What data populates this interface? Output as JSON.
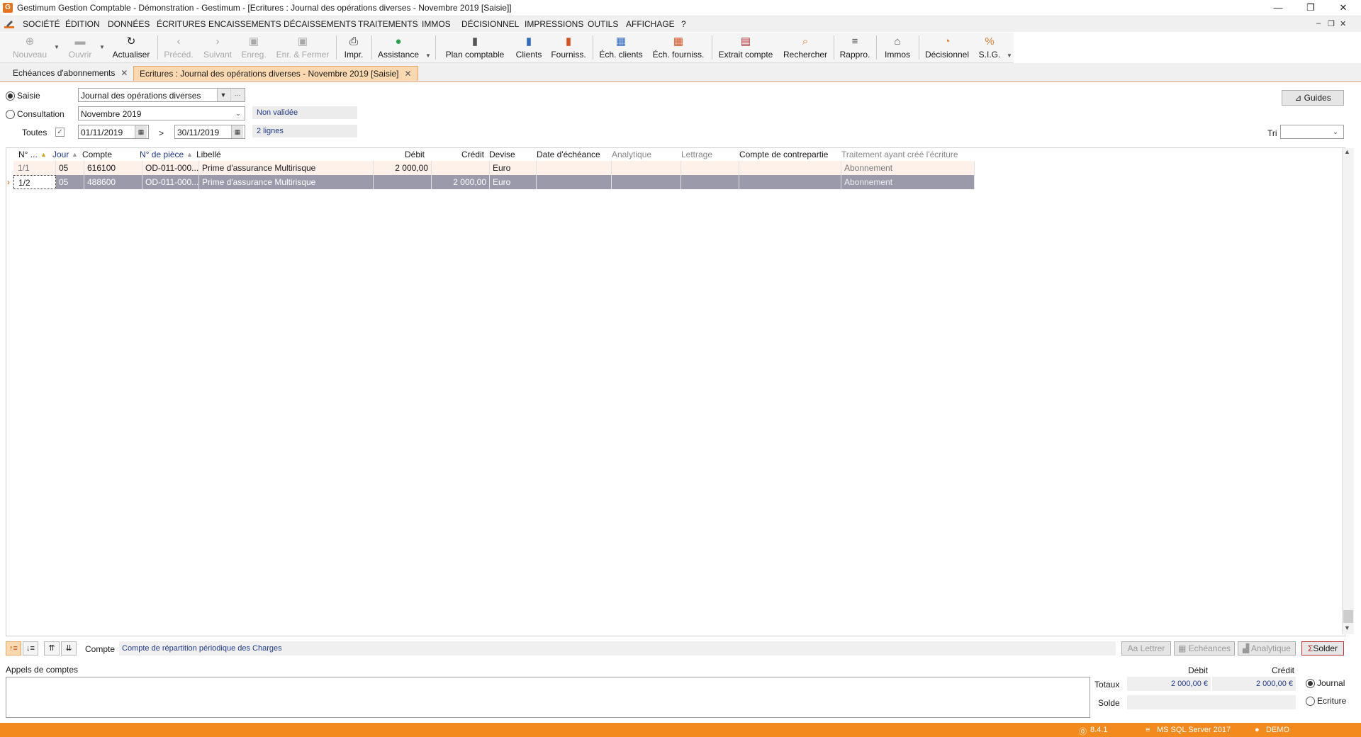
{
  "window": {
    "title": "Gestimum Gestion Comptable - Démonstration - Gestimum - [Ecritures : Journal des opérations diverses - Novembre 2019 [Saisie]]",
    "app_icon": "G",
    "minimize": "—",
    "restore": "❐",
    "close": "✕"
  },
  "menu": [
    "SOCIÉTÉ",
    "ÉDITION",
    "DONNÉES",
    "ÉCRITURES",
    "ENCAISSEMENTS",
    "DÉCAISSEMENTS",
    "TRAITEMENTS",
    "IMMOS",
    "DÉCISIONNEL",
    "IMPRESSIONS",
    "OUTILS",
    "AFFICHAGE",
    "?"
  ],
  "mdi_controls": [
    "–",
    "❐",
    "✕"
  ],
  "toolbar": {
    "nouveau": "Nouveau",
    "ouvrir": "Ouvrir",
    "actualiser": "Actualiser",
    "preced": "Précéd.",
    "suivant": "Suivant",
    "enreg": "Enreg.",
    "enr_fermer": "Enr. & Fermer",
    "impr": "Impr.",
    "assistance": "Assistance",
    "plan_comptable": "Plan comptable",
    "clients": "Clients",
    "fourniss": "Fourniss.",
    "ech_clients": "Éch. clients",
    "ech_fourniss": "Éch. fourniss.",
    "extrait_compte": "Extrait compte",
    "rechercher": "Rechercher",
    "rappro": "Rappro.",
    "immos": "Immos",
    "decisionnel": "Décisionnel",
    "sig": "S.I.G."
  },
  "tabs": [
    {
      "label": "Echéances d'abonnements",
      "close": "✕"
    },
    {
      "label": "Ecritures : Journal des opérations diverses - Novembre 2019 [Saisie]",
      "close": "✕"
    }
  ],
  "form": {
    "saisie_label": "Saisie",
    "consultation_label": "Consultation",
    "toutes_label": "Toutes",
    "journal_value": "Journal des opérations diverses",
    "period_value": "Novembre 2019",
    "date_from": "01/11/2019",
    "date_to": "30/11/2019",
    "date_sep": ">",
    "status": "Non validée",
    "line_count": "2 lignes",
    "guides_button": "Guides",
    "tri_label": "Tri",
    "ellipsis": "···"
  },
  "grid": {
    "columns": [
      "N° ...",
      "Jour",
      "Compte",
      "N° de pièce",
      "Libellé",
      "Débit",
      "Crédit",
      "Devise",
      "Date d'échéance",
      "Analytique",
      "Lettrage",
      "Compte de contrepartie",
      "Traitement ayant créé l'écriture"
    ],
    "rows": [
      {
        "num": "1/1",
        "jour": "05",
        "compte": "616100",
        "piece": "OD-011-000...",
        "libelle": "Prime d'assurance Multirisque",
        "debit": "2 000,00",
        "credit": "",
        "devise": "Euro",
        "echeance": "",
        "analytique": "",
        "lettrage": "",
        "contrepartie": "",
        "traitement": "Abonnement"
      },
      {
        "num": "1/2",
        "jour": "05",
        "compte": "488600",
        "piece": "OD-011-000...",
        "libelle": "Prime d'assurance Multirisque",
        "debit": "",
        "credit": "2 000,00",
        "devise": "Euro",
        "echeance": "",
        "analytique": "",
        "lettrage": "",
        "contrepartie": "",
        "traitement": "Abonnement"
      }
    ],
    "current_row_marker": "›"
  },
  "bottom": {
    "compte_label": "Compte",
    "compte_value": "Compte de répartition périodique des Charges",
    "lettrer_button": "Lettrer",
    "echeances_button": "Echéances",
    "analytique_button": "Analytique",
    "solder_button": "Solder",
    "appels_label": "Appels de comptes",
    "debit_header": "Débit",
    "credit_header": "Crédit",
    "totaux_label": "Totaux",
    "solde_label": "Solde",
    "total_debit": "2 000,00 €",
    "total_credit": "2 000,00 €",
    "journal_option": "Journal",
    "ecriture_option": "Ecriture"
  },
  "status": {
    "version": "8.4.1",
    "database": "MS SQL Server 2017",
    "user": "DEMO"
  },
  "colors": {
    "accent": "#f28a1e",
    "tab_active": "#fbd9b0",
    "selected_row": "#9a9aaa",
    "link_blue": "#1f3a8a"
  }
}
